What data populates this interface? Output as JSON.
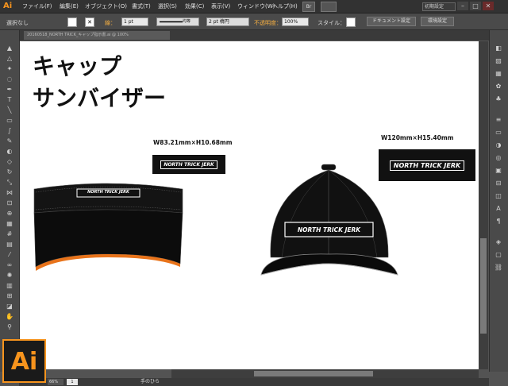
{
  "app": {
    "logo": "Ai",
    "big_logo": "Ai"
  },
  "menu": [
    "ファイル(F)",
    "編集(E)",
    "オブジェクト(O)",
    "書式(T)",
    "選択(S)",
    "効果(C)",
    "表示(V)",
    "ウィンドウ(W)",
    "ヘルプ(H)"
  ],
  "workspace": "初期設定",
  "control": {
    "selection": "選択なし",
    "stroke_label": "線：",
    "stroke_value": "1 pt",
    "brush": "均等",
    "brush_style": "2 pt 楕円",
    "opacity_label": "不透明度：",
    "opacity_value": "100%",
    "style_label": "スタイル：",
    "doc_settings": "ドキュメント設定",
    "prefs": "環境設定"
  },
  "doc_tab": "20160518_NORTH TRICK_キャップ指示書.ai @ 100%",
  "status": {
    "zoom": "66%",
    "artboard": "1",
    "tool": "手のひら"
  },
  "artwork": {
    "title_line1": "キャップ",
    "title_line2": "サンバイザー",
    "visor_size": "W83.21mm×H10.68mm",
    "cap_size": "W120mm×H15.40mm",
    "logo": "NORTH TRICK JERK"
  },
  "colors": {
    "accent": "#f7941d",
    "visor_brim_edge": "#e8731a",
    "canvas": "#ffffff",
    "cap": "#111111"
  }
}
